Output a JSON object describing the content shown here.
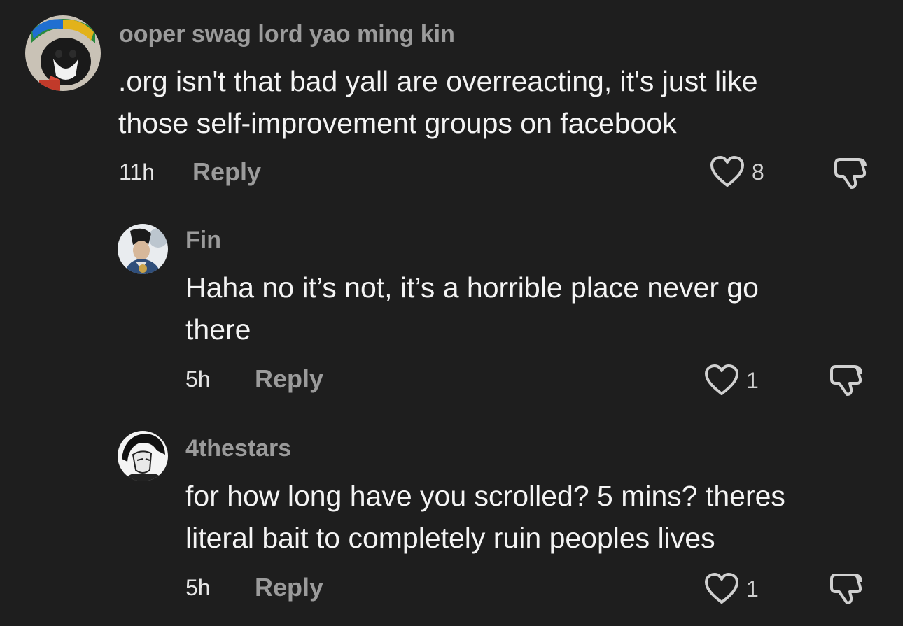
{
  "comments": [
    {
      "username": "ooper swag lord yao ming kin",
      "text_lines": [
        ".org isn't that bad yall are overreacting, it's just like",
        "those self-improvement groups on facebook"
      ],
      "time": "11h",
      "reply_label": "Reply",
      "likes": "8",
      "avatar_icon": "cat-avatar"
    },
    {
      "username": "Fin",
      "text_lines": [
        "Haha no it’s not, it’s a horrible place never go",
        "there"
      ],
      "time": "5h",
      "reply_label": "Reply",
      "likes": "1",
      "avatar_icon": "anime-character-avatar"
    },
    {
      "username": "4thestars",
      "text_lines": [
        "for how long have you scrolled? 5 mins? theres",
        "literal bait to completely ruin peoples lives"
      ],
      "time": "5h",
      "reply_label": "Reply",
      "likes": "1",
      "avatar_icon": "manga-character-avatar"
    }
  ],
  "colors": {
    "background": "#1e1e1e",
    "username": "#9b9b9b",
    "text": "#f4f4f4",
    "icon": "#d0d0d0"
  }
}
